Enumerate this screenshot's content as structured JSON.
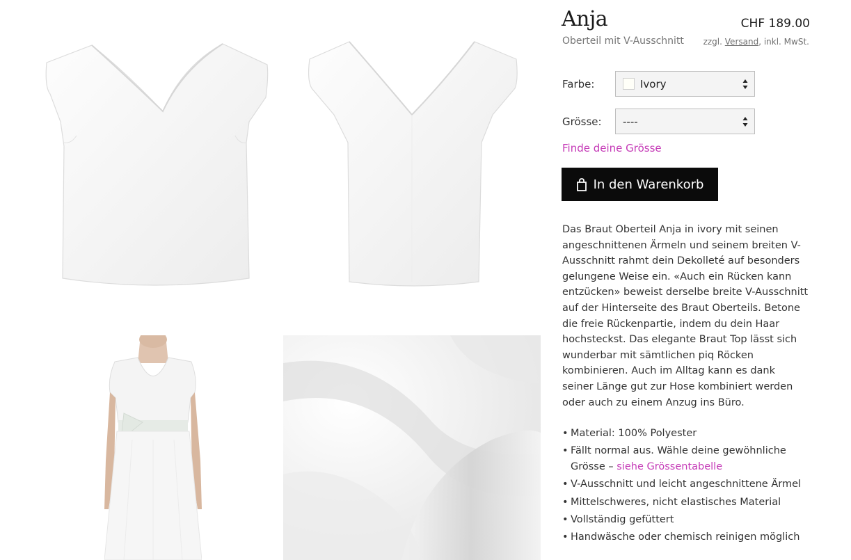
{
  "product": {
    "name": "Anja",
    "subtitle": "Oberteil mit V-Ausschnitt",
    "price": "CHF 189.00",
    "shipping_prefix": "zzgl.",
    "shipping_link": "Versand",
    "shipping_suffix": ", inkl. MwSt."
  },
  "options": {
    "color_label": "Farbe:",
    "color_value": "Ivory",
    "size_label": "Grösse:",
    "size_value": "----",
    "size_guide_link": "Finde deine Grösse"
  },
  "cart": {
    "button_label": "In den Warenkorb",
    "icon": "shopping-bag-icon"
  },
  "description": "Das Braut Oberteil Anja in ivory mit seinen angeschnittenen Ärmeln und seinem breiten V-Ausschnitt rahmt dein Dekolleté auf besonders gelungene Weise ein. «Auch ein Rücken kann entzücken» beweist derselbe breite V-Ausschnitt auf der Hinterseite des Braut Oberteils. Betone die freie Rückenpartie, indem du dein Haar hochsteckst. Das elegante Braut Top lässt sich wunderbar mit sämtlichen piq Röcken kombinieren. Auch im Alltag kann es dank seiner Länge gut zur Hose kombiniert werden oder auch zu einem Anzug ins Büro.",
  "features": [
    "Material: 100% Polyester",
    "Fällt normal aus. Wähle deine gewöhnliche Grösse – ",
    "V-Ausschnitt und leicht angeschnittene Ärmel",
    "Mittelschweres, nicht elastisches Material",
    "Vollständig gefüttert",
    "Handwäsche oder chemisch reinigen möglich"
  ],
  "features_link": "siehe Grössentabelle",
  "colors": {
    "accent_link": "#c53bb7",
    "button_bg": "#0b0b0b",
    "text": "#333333"
  }
}
